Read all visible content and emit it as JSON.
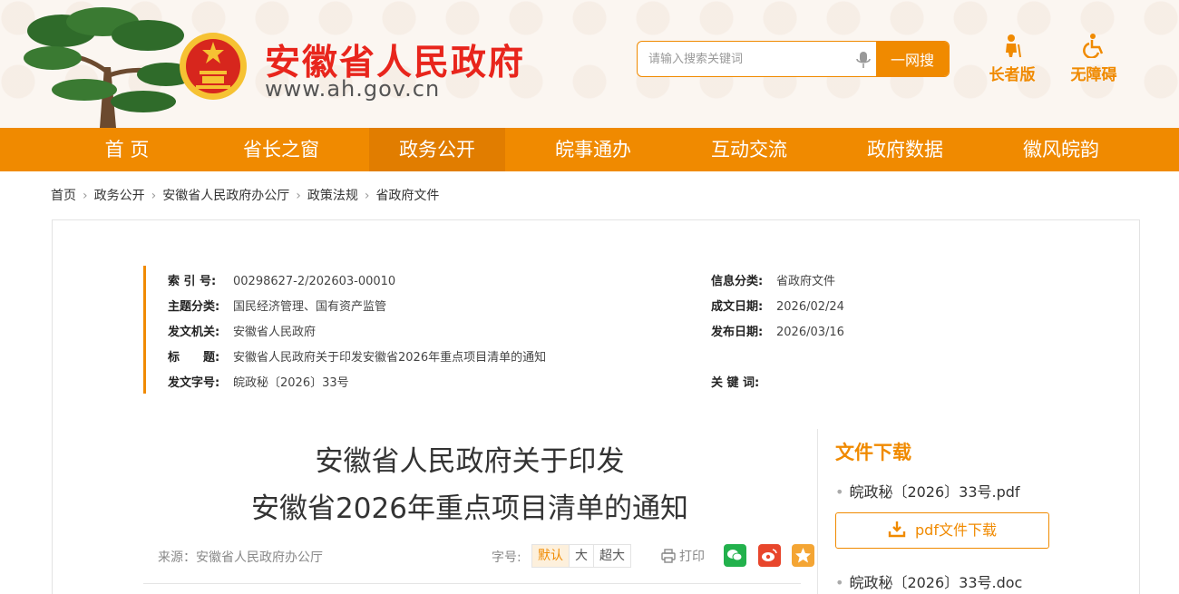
{
  "header": {
    "site_title": "安徽省人民政府",
    "site_url": "www.ah.gov.cn",
    "search_placeholder": "请输入搜索关键词",
    "search_button": "一网搜",
    "elder_mode": "长者版",
    "accessibility_mode": "无障碍"
  },
  "nav": {
    "items": [
      {
        "label": "首 页",
        "active": false
      },
      {
        "label": "省长之窗",
        "active": false
      },
      {
        "label": "政务公开",
        "active": true
      },
      {
        "label": "皖事通办",
        "active": false
      },
      {
        "label": "互动交流",
        "active": false
      },
      {
        "label": "政府数据",
        "active": false
      },
      {
        "label": "徽风皖韵",
        "active": false
      }
    ]
  },
  "breadcrumb": [
    "首页",
    "政务公开",
    "安徽省人民政府办公厅",
    "政策法规",
    "省政府文件"
  ],
  "meta": {
    "index_no_label": "索 引 号:",
    "index_no": "00298627-2/202603-00010",
    "topic_label": "主题分类:",
    "topic": "国民经济管理、国有资产监管",
    "issuer_label": "发文机关:",
    "issuer": "安徽省人民政府",
    "title_label": "标　　题:",
    "title": "安徽省人民政府关于印发安徽省2026年重点项目清单的通知",
    "doc_no_label": "发文字号:",
    "doc_no": "皖政秘〔2026〕33号",
    "info_category_label": "信息分类:",
    "info_category": "省政府文件",
    "created_date_label": "成文日期:",
    "created_date": "2026/02/24",
    "publish_date_label": "发布日期:",
    "publish_date": "2026/03/16",
    "keywords_label": "关 键 词:",
    "keywords": ""
  },
  "document": {
    "title_line1": "安徽省人民政府关于印发",
    "title_line2": "安徽省2026年重点项目清单的通知",
    "source": "来源：安徽省人民政府办公厅",
    "font_size_label": "字号:",
    "font_sizes": [
      "默认",
      "大",
      "超大"
    ],
    "print_label": "打印"
  },
  "downloads": {
    "title": "文件下载",
    "file1": "皖政秘〔2026〕33号.pdf",
    "pdf_button": "pdf文件下载",
    "file2": "皖政秘〔2026〕33号.doc"
  },
  "colors": {
    "accent": "#f08a00",
    "brand_red": "#e8251c",
    "wechat": "#22b14c",
    "weibo": "#e8462c",
    "favorite": "#f4a534"
  }
}
